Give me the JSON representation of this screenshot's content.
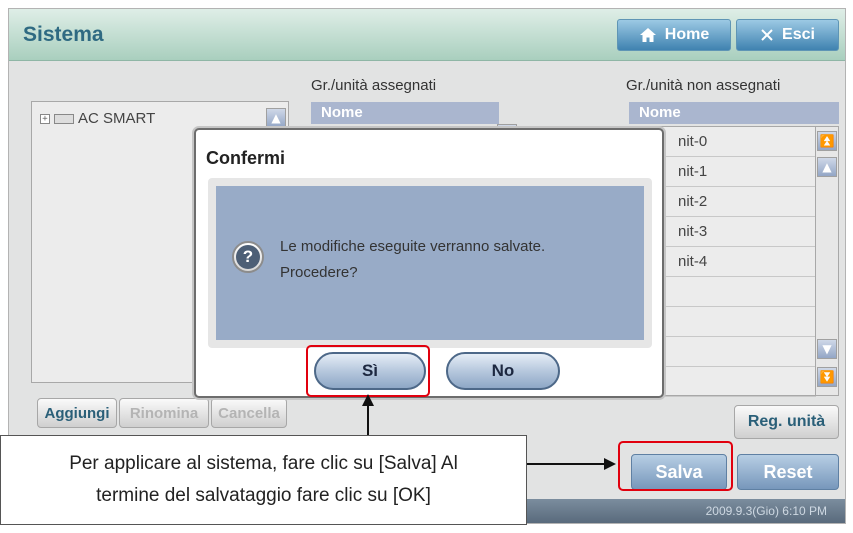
{
  "header": {
    "title": "Sistema",
    "home_label": "Home",
    "exit_label": "Esci"
  },
  "columns": {
    "assigned_title": "Gr./unità assegnati",
    "unassigned_title": "Gr./unità non assegnati",
    "name_header": "Nome"
  },
  "tree": {
    "items": [
      {
        "label": "AC SMART"
      }
    ]
  },
  "unassigned_list": {
    "rows": [
      "nit-0",
      "nit-1",
      "nit-2",
      "nit-3",
      "nit-4",
      "",
      "",
      "",
      ""
    ]
  },
  "left_buttons": {
    "add": "Aggiungi",
    "rename": "Rinomina",
    "delete": "Cancella"
  },
  "right_buttons": {
    "register_unit": "Reg. unità",
    "save": "Salva",
    "reset": "Reset"
  },
  "status": {
    "datetime": "2009.9.3(Gio) 6:10 PM"
  },
  "dialog": {
    "title": "Confermi",
    "icon": "question-icon",
    "icon_glyph": "?",
    "message_line1": "Le modifiche eseguite verranno salvate.",
    "message_line2": "Procedere?",
    "yes_label": "Sì",
    "no_label": "No"
  },
  "callout": {
    "line1": "Per applicare al sistema, fare clic su [Salva] Al",
    "line2": "termine del salvataggio fare clic su [OK]"
  },
  "colors": {
    "title_text": "#2f6a82",
    "highlight": "#e1000e",
    "header_gradient_top": "#dfeee7",
    "button_blue": "#3f82b0"
  }
}
